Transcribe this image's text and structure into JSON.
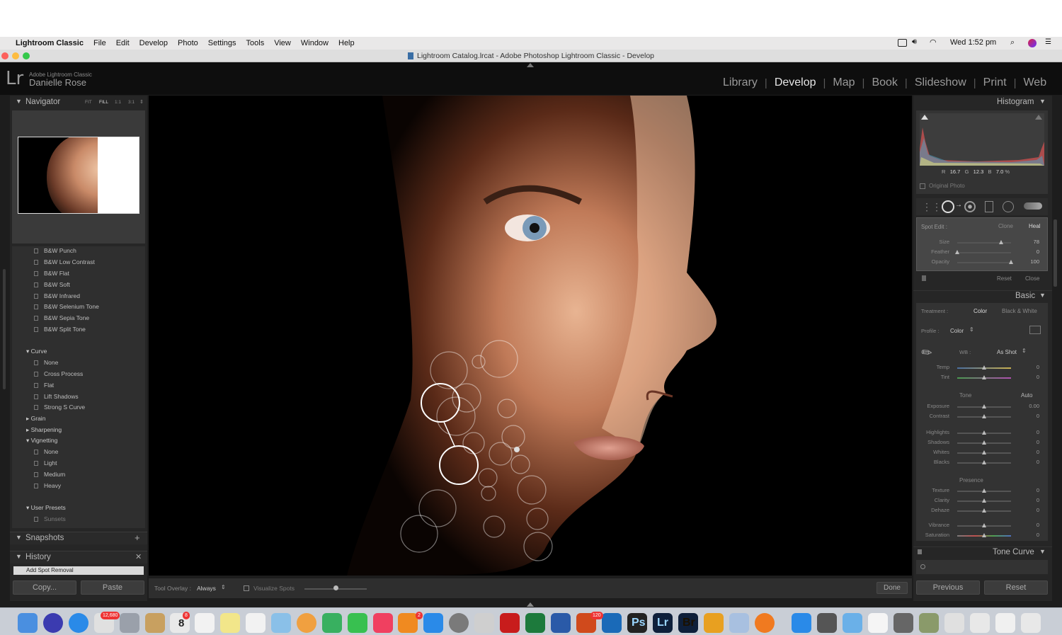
{
  "menubar": {
    "app_name": "Lightroom Classic",
    "items": [
      "File",
      "Edit",
      "Develop",
      "Photo",
      "Settings",
      "Tools",
      "View",
      "Window",
      "Help"
    ],
    "clock": "Wed 1:52 pm"
  },
  "window": {
    "title": "Lightroom Catalog.lrcat - Adobe Photoshop Lightroom Classic - Develop"
  },
  "identity": {
    "logo": "Lr",
    "product": "Adobe Lightroom Classic",
    "user": "Danielle Rose"
  },
  "modules": [
    "Library",
    "Develop",
    "Map",
    "Book",
    "Slideshow",
    "Print",
    "Web"
  ],
  "active_module": "Develop",
  "left_panel": {
    "navigator": {
      "title": "Navigator",
      "zoom_options": [
        "FIT",
        "FILL",
        "1:1",
        "3:1"
      ]
    },
    "presets_bw": [
      "B&W Punch",
      "B&W Low Contrast",
      "B&W Flat",
      "B&W Soft",
      "B&W Infrared",
      "B&W Selenium Tone",
      "B&W Sepia Tone",
      "B&W Split Tone"
    ],
    "curve_group": {
      "label": "Curve",
      "items": [
        "None",
        "Cross Process",
        "Flat",
        "Lift Shadows",
        "Strong S Curve"
      ]
    },
    "grain_label": "Grain",
    "sharpening_label": "Sharpening",
    "vignetting_group": {
      "label": "Vignetting",
      "items": [
        "None",
        "Light",
        "Medium",
        "Heavy"
      ]
    },
    "user_presets": {
      "label": "User Presets",
      "items": [
        "Sunsets"
      ]
    },
    "snapshots_label": "Snapshots",
    "history_label": "History",
    "history_item": "Add Spot Removal",
    "copy_label": "Copy...",
    "paste_label": "Paste"
  },
  "toolbar": {
    "tool_overlay_label": "Tool Overlay :",
    "tool_overlay_value": "Always",
    "visualize_spots_label": "Visualize Spots",
    "visualize_level": 0.5,
    "done_label": "Done"
  },
  "right_panel": {
    "histogram_title": "Histogram",
    "rgb_readout": {
      "r_label": "R",
      "r": "16.7",
      "g_label": "G",
      "g": "12.3",
      "b_label": "B",
      "b": "7.0",
      "unit": "%"
    },
    "original_photo_label": "Original Photo",
    "spot_edit": {
      "label": "Spot Edit :",
      "clone": "Clone",
      "heal": "Heal",
      "sliders": [
        {
          "label": "Size",
          "value": "78",
          "pos": 0.82
        },
        {
          "label": "Feather",
          "value": "0",
          "pos": 0.0
        },
        {
          "label": "Opacity",
          "value": "100",
          "pos": 1.0
        }
      ],
      "reset": "Reset",
      "close": "Close"
    },
    "basic": {
      "title": "Basic",
      "treatment_label": "Treatment :",
      "color": "Color",
      "bw": "Black & White",
      "profile_label": "Profile :",
      "profile_value": "Color",
      "wb_label": "WB :",
      "wb_value": "As Shot",
      "temp_tint": [
        {
          "label": "Temp",
          "value": "0",
          "pos": 0.5
        },
        {
          "label": "Tint",
          "value": "0",
          "pos": 0.5
        }
      ],
      "tone_label": "Tone",
      "auto_label": "Auto",
      "tone_a": [
        {
          "label": "Exposure",
          "value": "0.00",
          "pos": 0.5
        },
        {
          "label": "Contrast",
          "value": "0",
          "pos": 0.5
        }
      ],
      "tone_b": [
        {
          "label": "Highlights",
          "value": "0",
          "pos": 0.5
        },
        {
          "label": "Shadows",
          "value": "0",
          "pos": 0.5
        },
        {
          "label": "Whites",
          "value": "0",
          "pos": 0.5
        },
        {
          "label": "Blacks",
          "value": "0",
          "pos": 0.5
        }
      ],
      "presence_label": "Presence",
      "presence_a": [
        {
          "label": "Texture",
          "value": "0",
          "pos": 0.5
        },
        {
          "label": "Clarity",
          "value": "0",
          "pos": 0.5
        },
        {
          "label": "Dehaze",
          "value": "0",
          "pos": 0.5
        }
      ],
      "presence_b": [
        {
          "label": "Vibrance",
          "value": "0",
          "pos": 0.5
        },
        {
          "label": "Saturation",
          "value": "0",
          "pos": 0.5
        }
      ]
    },
    "tone_curve_title": "Tone Curve",
    "previous_label": "Previous",
    "reset_label": "Reset"
  },
  "dock": {
    "badges": [
      "12,680",
      "8",
      "2",
      "120"
    ],
    "icons": [
      "finder",
      "siri",
      "safari",
      "mail",
      "launchpad",
      "notes",
      "contacts",
      "calendar",
      "stickies",
      "reminders",
      "maps",
      "photos",
      "messages",
      "facetime",
      "music",
      "books",
      "app-store",
      "system-preferences",
      "printer",
      "acrobat",
      "excel",
      "word",
      "powerpoint",
      "outlook",
      "camera",
      "photoshop",
      "lightroom",
      "bridge",
      "preview",
      "firefox",
      "zoom",
      "scanner",
      "folder",
      "document",
      "screenshots",
      "photo-viewer",
      "window",
      "spreadsheet",
      "mail-doc",
      "trash"
    ]
  },
  "dock_labels": {
    "calendar_day": "8",
    "ps": "Ps",
    "lr": "Lr",
    "br": "Br"
  },
  "colors": {
    "accent_bar": "#c4c4c4",
    "panel_bg": "#2b2b2b",
    "lr_bg": "#1d1d1d"
  }
}
